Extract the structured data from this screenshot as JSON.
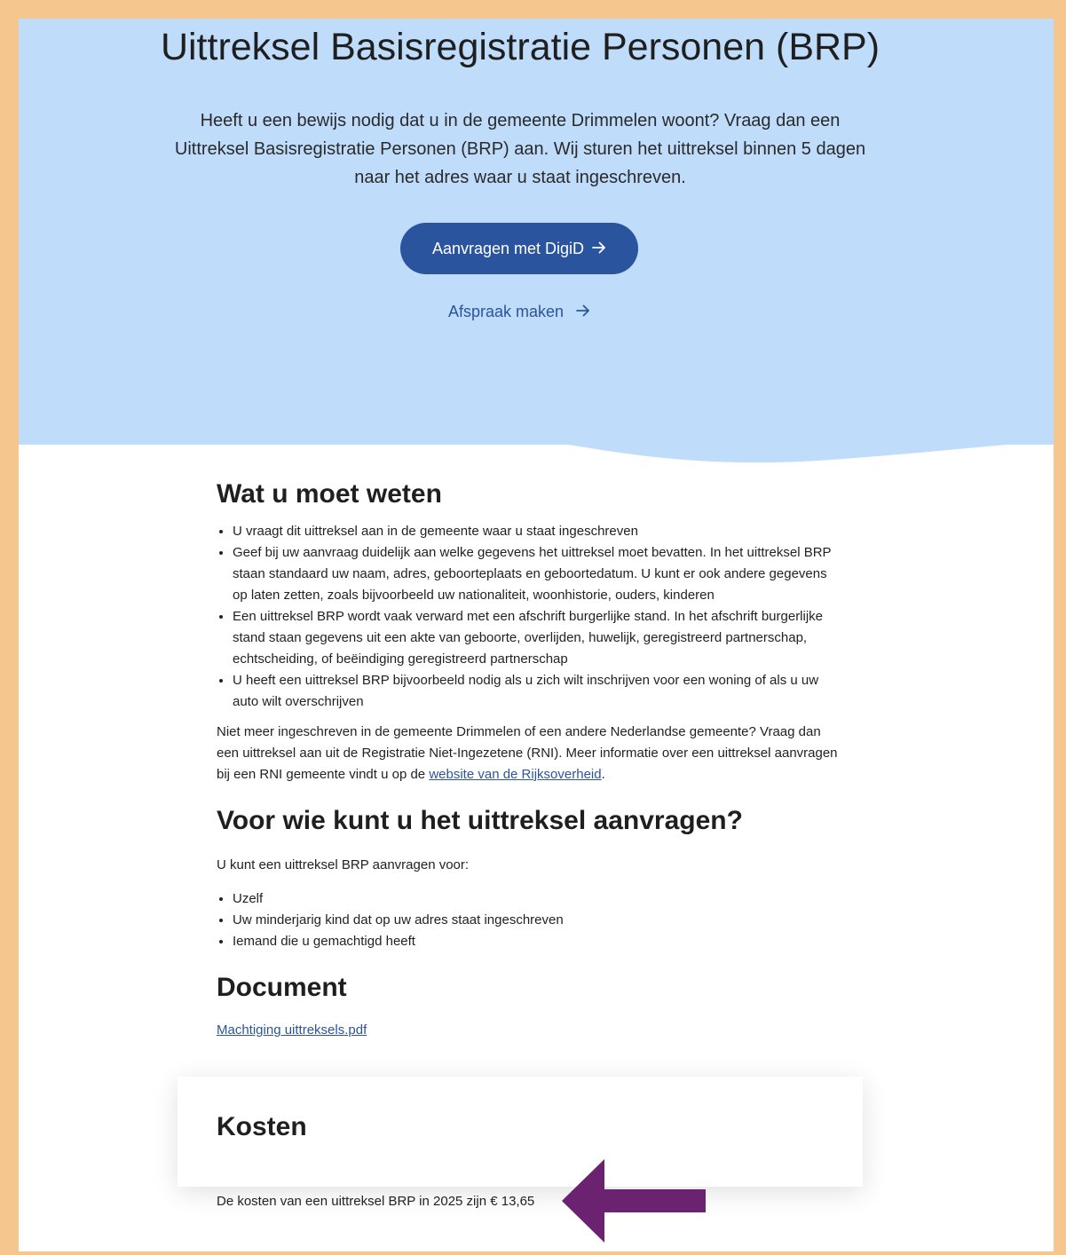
{
  "hero": {
    "title": "Uittreksel Basisregistratie Personen (BRP)",
    "intro": "Heeft u een bewijs nodig dat u in de gemeente Drimmelen woont? Vraag dan een Uittreksel Basisregistratie Personen (BRP) aan. Wij sturen het uittreksel binnen 5 dagen naar het adres waar u staat ingeschreven.",
    "digid_button": "Aanvragen met DigiD",
    "appointment_link": "Afspraak maken"
  },
  "wat": {
    "heading": "Wat u moet weten",
    "items": [
      "U vraagt dit uittreksel aan in de gemeente waar u staat ingeschreven",
      "Geef bij uw aanvraag duidelijk aan welke gegevens het uittreksel moet bevatten. In het uittreksel BRP staan standaard uw naam, adres, geboorteplaats en geboortedatum. U kunt er ook andere gegevens op laten zetten, zoals bijvoorbeeld uw nationaliteit, woonhistorie, ouders, kinderen",
      "Een uittreksel BRP wordt vaak verward met een afschrift burgerlijke stand. In het afschrift burgerlijke stand staan gegevens uit een akte van geboorte, overlijden, huwelijk, geregistreerd partnerschap, echtscheiding, of beëindiging geregistreerd partnerschap",
      "U heeft een uittreksel BRP bijvoorbeeld nodig als u zich wilt inschrijven voor een woning of als u uw auto wilt overschrijven"
    ],
    "niet_meer_text": "Niet meer ingeschreven in de gemeente Drimmelen of een andere Nederlandse gemeente? Vraag dan een uittreksel aan uit de Registratie Niet-Ingezetene (RNI). Meer informatie over een uittreksel aanvragen bij een RNI gemeente vindt u op de ",
    "rijksoverheid_link": "website van de Rijksoverheid",
    "period": "."
  },
  "voor": {
    "heading": "Voor wie kunt u het uittreksel aanvragen?",
    "intro": "U kunt een uittreksel BRP aanvragen voor:",
    "items": [
      "Uzelf",
      "Uw minderjarig kind dat op uw adres staat ingeschreven",
      "Iemand die u gemachtigd heeft"
    ]
  },
  "document": {
    "heading": "Document",
    "link": "Machtiging uittreksels.pdf"
  },
  "kosten": {
    "heading": "Kosten",
    "text": "De kosten van een uittreksel BRP in 2025 zijn € 13,65"
  },
  "icons": {
    "button_arrow": "arrow-right-icon",
    "link_arrow": "arrow-right-icon",
    "annotation": "purple-arrow-left-icon"
  },
  "colors": {
    "frame_border": "#f5c78f",
    "hero_background": "#bfdcfb",
    "primary": "#2b549f",
    "annotation_arrow": "#6b2270"
  }
}
